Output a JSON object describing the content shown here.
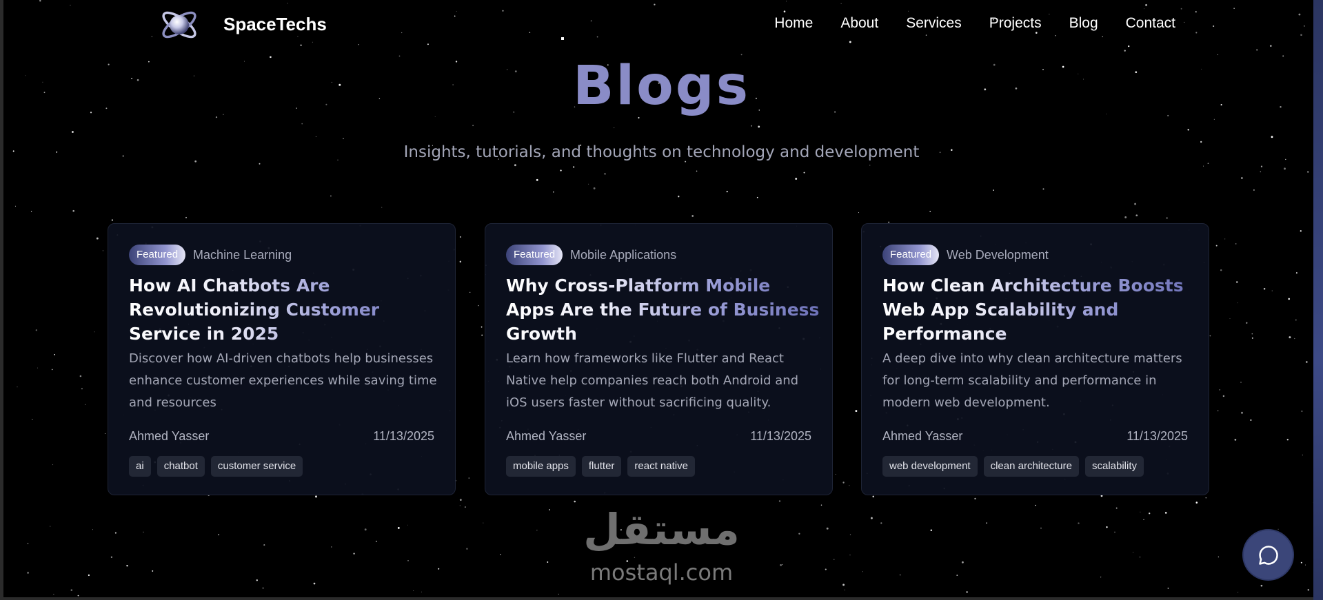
{
  "nav": {
    "brand": "SpaceTechs",
    "links": [
      "Home",
      "About",
      "Services",
      "Projects",
      "Blog",
      "Contact"
    ]
  },
  "hero": {
    "title": "Blogs",
    "subtitle": "Insights, tutorials, and thoughts on technology and development"
  },
  "posts": [
    {
      "badge": "Featured",
      "category": "Machine Learning",
      "title": "How AI Chatbots Are Revolutionizing Customer Service in 2025",
      "description": "Discover how AI-driven chatbots help businesses enhance customer experiences while saving time and resources",
      "author": "Ahmed Yasser",
      "date": "11/13/2025",
      "tags": [
        "ai",
        "chatbot",
        "customer service"
      ]
    },
    {
      "badge": "Featured",
      "category": "Mobile Applications",
      "title": "Why Cross-Platform Mobile Apps Are the Future of Business Growth",
      "description": "Learn how frameworks like Flutter and React Native help companies reach both Android and iOS users faster without sacrificing quality.",
      "author": "Ahmed Yasser",
      "date": "11/13/2025",
      "tags": [
        "mobile apps",
        "flutter",
        "react native"
      ]
    },
    {
      "badge": "Featured",
      "category": "Web Development",
      "title": "How Clean Architecture Boosts Web App Scalability and Performance",
      "description": "A deep dive into why clean architecture matters for long-term scalability and performance in modern web development.",
      "author": "Ahmed Yasser",
      "date": "11/13/2025",
      "tags": [
        "web development",
        "clean architecture",
        "scalability"
      ]
    }
  ],
  "watermark": {
    "arabic": "مستقل",
    "latin": "mostaql.com"
  },
  "icons": {
    "logo": "planet-orbit-icon",
    "chat": "chat-bubble-icon"
  },
  "colors": {
    "background": "#000000",
    "accent": "#8a8cc7",
    "card_bg": "#0c101e",
    "chat_button": "#3b4679"
  }
}
